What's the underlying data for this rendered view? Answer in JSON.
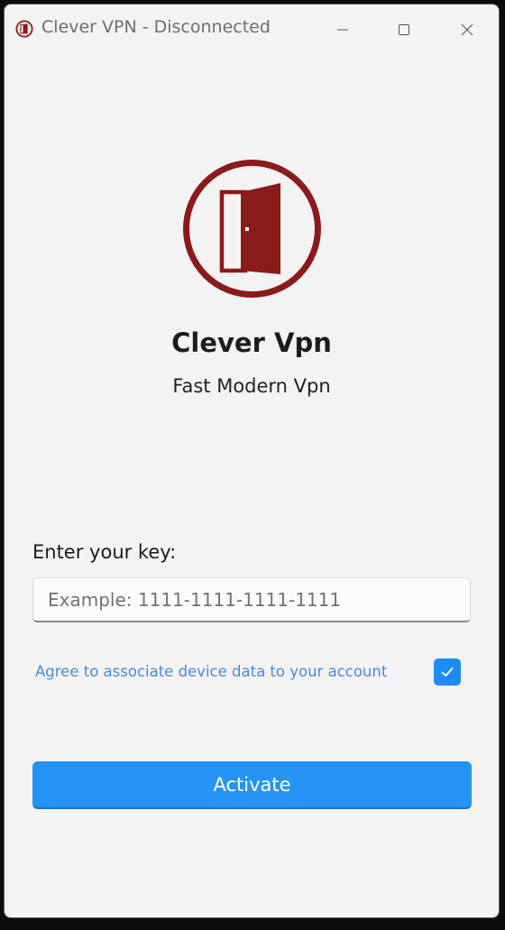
{
  "window": {
    "title": "Clever VPN - Disconnected",
    "minimize_icon": "minimize-icon",
    "maximize_icon": "maximize-icon",
    "close_icon": "close-icon"
  },
  "branding": {
    "logo_icon": "door-open-icon",
    "logo_color": "#8b1a1a",
    "app_name": "Clever Vpn",
    "tagline": "Fast Modern Vpn"
  },
  "form": {
    "key_label": "Enter your key:",
    "key_value": "",
    "key_placeholder": "Example: 1111-1111-1111-1111",
    "agree_label": "Agree to associate device data to your account",
    "agree_checked": true,
    "agree_color": "#4c8bd6",
    "activate_label": "Activate",
    "accent_color": "#2694f5"
  }
}
